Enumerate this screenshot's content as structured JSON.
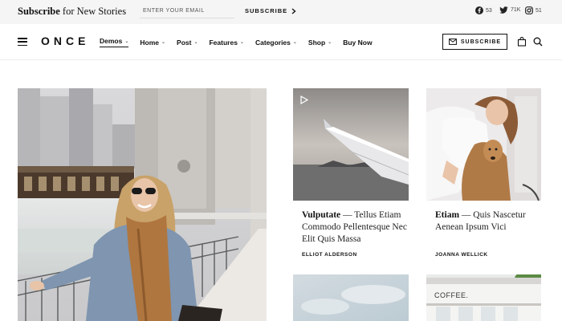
{
  "topbar": {
    "brand": "Subscribe",
    "title_rest": " for New Stories",
    "email_placeholder": "ENTER YOUR EMAIL",
    "subscribe_label": "SUBSCRIBE",
    "social": [
      {
        "icon": "facebook-icon",
        "count": "53"
      },
      {
        "icon": "twitter-icon",
        "count": "71K"
      },
      {
        "icon": "instagram-icon",
        "count": "51"
      }
    ]
  },
  "nav": {
    "logo": "ONCE",
    "items": [
      {
        "label": "Demos",
        "has_dropdown": true,
        "active": true
      },
      {
        "label": "Home",
        "has_dropdown": true
      },
      {
        "label": "Post",
        "has_dropdown": true
      },
      {
        "label": "Features",
        "has_dropdown": true
      },
      {
        "label": "Categories",
        "has_dropdown": true
      },
      {
        "label": "Shop",
        "has_dropdown": true
      },
      {
        "label": "Buy Now",
        "has_dropdown": false
      }
    ],
    "subscribe_label": "SUBSCRIBE"
  },
  "cards": [
    {
      "title_bold": "Vulputate",
      "title_rest": " — Tellus Etiam Commodo Pellentesque Nec Elit Quis Massa",
      "author": "ELLIOT ALDERSON"
    },
    {
      "title_bold": "Etiam",
      "title_rest": " — Quis Nascetur Aenean Ipsum Vici",
      "author": "JOANNA WELLICK"
    }
  ],
  "shop_sign": "COFFEE.",
  "colors": {
    "topbar_bg": "#f5f5f5",
    "text": "#111111",
    "border": "#111111"
  }
}
